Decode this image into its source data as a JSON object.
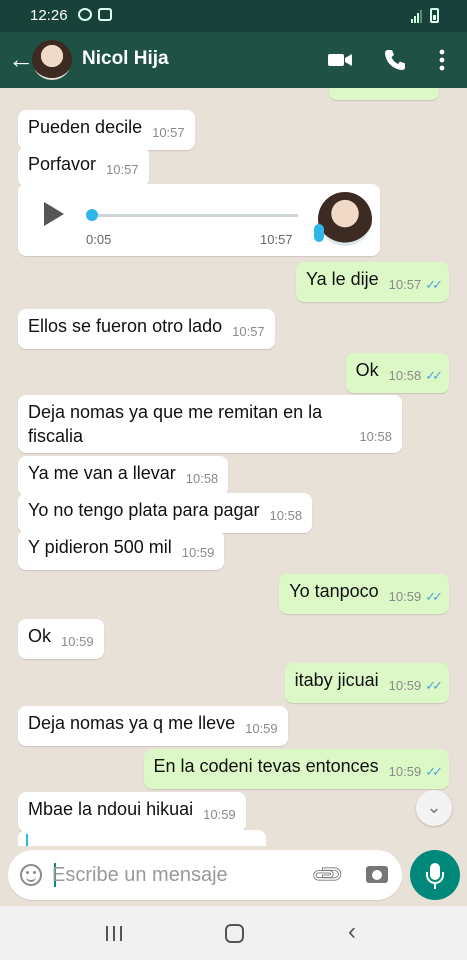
{
  "status": {
    "time": "12:26"
  },
  "header": {
    "contact_name": "Nicol Hija"
  },
  "messages": [
    {
      "dir": "in",
      "text": "Pueden decile",
      "time": "10:57"
    },
    {
      "dir": "in",
      "text": "Porfavor",
      "time": "10:57"
    },
    {
      "dir": "out",
      "text": "Ya le dije",
      "time": "10:57"
    },
    {
      "dir": "in",
      "text": "Ellos se fueron otro lado",
      "time": "10:57"
    },
    {
      "dir": "out",
      "text": "Ok",
      "time": "10:58"
    },
    {
      "dir": "in",
      "text": "Deja nomas ya que me remitan en la fiscalia",
      "time": "10:58"
    },
    {
      "dir": "in",
      "text": "Ya me van a llevar",
      "time": "10:58"
    },
    {
      "dir": "in",
      "text": "Yo no tengo plata para pagar",
      "time": "10:58"
    },
    {
      "dir": "in",
      "text": "Y pidieron 500 mil",
      "time": "10:59"
    },
    {
      "dir": "out",
      "text": "Yo tanpoco",
      "time": "10:59"
    },
    {
      "dir": "in",
      "text": "Ok",
      "time": "10:59"
    },
    {
      "dir": "out",
      "text": "itaby jicuai",
      "time": "10:59"
    },
    {
      "dir": "in",
      "text": "Deja nomas ya q me lleve",
      "time": "10:59"
    },
    {
      "dir": "out",
      "text": "En la codeni tevas entonces",
      "time": "10:59"
    },
    {
      "dir": "in",
      "text": "Mbae la ndoui hikuai",
      "time": "10:59"
    }
  ],
  "voice_note": {
    "duration": "0:05",
    "time": "10:57",
    "progress": 0
  },
  "compose": {
    "placeholder": "Escribe un mensaje"
  },
  "icons": [
    "back-arrow-icon",
    "video-call-icon",
    "phone-icon",
    "more-vert-icon",
    "play-icon",
    "emoji-icon",
    "attach-icon",
    "camera-icon",
    "mic-icon",
    "double-check-icon",
    "chevron-down-icon"
  ],
  "colors": {
    "header": "#1f5145",
    "outgoing": "#dcf8c6",
    "incoming": "#ffffff",
    "accent": "#00897b",
    "read_ticks": "#4fa4de"
  }
}
